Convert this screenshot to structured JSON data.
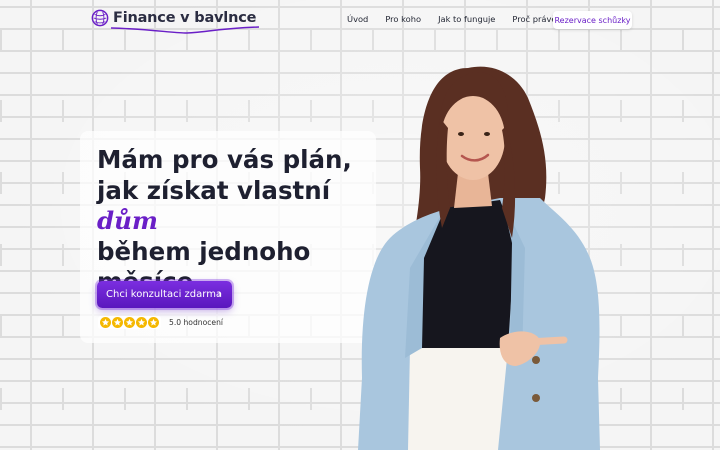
{
  "brand": {
    "name": "Finance v bavlnce",
    "accent": "#6a1fc7"
  },
  "nav": {
    "links": [
      "Úvod",
      "Pro koho",
      "Jak to funguje",
      "Proč právě já"
    ],
    "cta": "Rezervace schůzky"
  },
  "hero": {
    "headline_line1": "Mám pro vás plán,",
    "headline_line2_pre": "jak získat vlastní ",
    "headline_highlight": "dům",
    "headline_line3": "během jednoho",
    "headline_line4": "měsíce.",
    "cta_label": "Chci konzultaci zdarma",
    "cta_icon": "chevron-right-icon",
    "rating_stars": 5,
    "rating_text": "5.0 hodnocení"
  }
}
